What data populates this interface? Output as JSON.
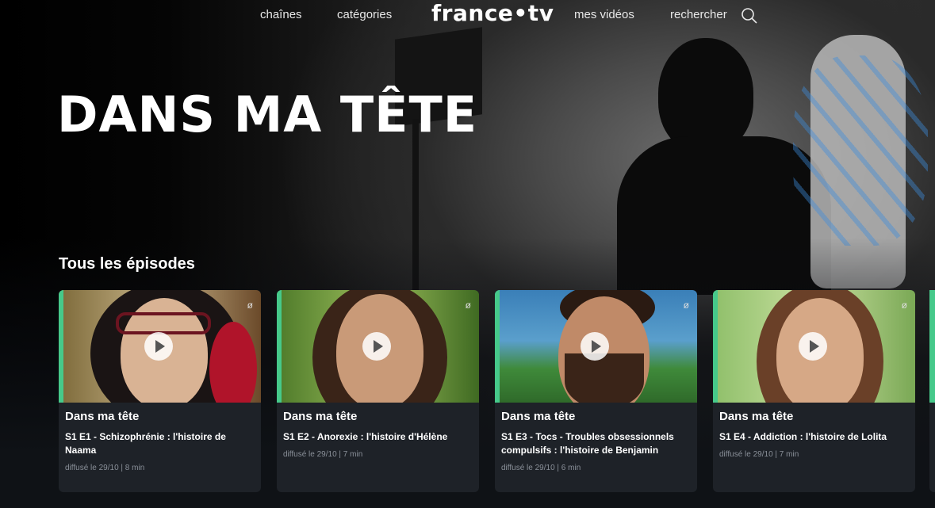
{
  "nav": {
    "links": [
      "chaînes",
      "catégories",
      "mes vidéos",
      "rechercher"
    ],
    "brand": "france•tv"
  },
  "hero": {
    "title": "DANS MA TÊTE"
  },
  "section": {
    "title": "Tous les épisodes"
  },
  "cards": [
    {
      "series": "Dans ma tête",
      "episode": "S1 E1 - Schizophrénie : l'histoire de Naama",
      "meta": "diffusé le 29/10  |  8 min",
      "rating": "ø"
    },
    {
      "series": "Dans ma tête",
      "episode": "S1 E2 - Anorexie : l'histoire d'Hélène",
      "meta": "diffusé le 29/10  |  7 min",
      "rating": "ø"
    },
    {
      "series": "Dans ma tête",
      "episode": "S1 E3 - Tocs - Troubles obsessionnels compulsifs : l'histoire de Benjamin",
      "meta": "diffusé le 29/10  |  6 min",
      "rating": "ø"
    },
    {
      "series": "Dans ma tête",
      "episode": "S1 E4 - Addiction : l'histoire de Lolita",
      "meta": "diffusé le 29/10  |  7 min",
      "rating": "ø"
    }
  ],
  "colors": {
    "accent": "#46c98a",
    "card_bg": "#1e2228"
  }
}
